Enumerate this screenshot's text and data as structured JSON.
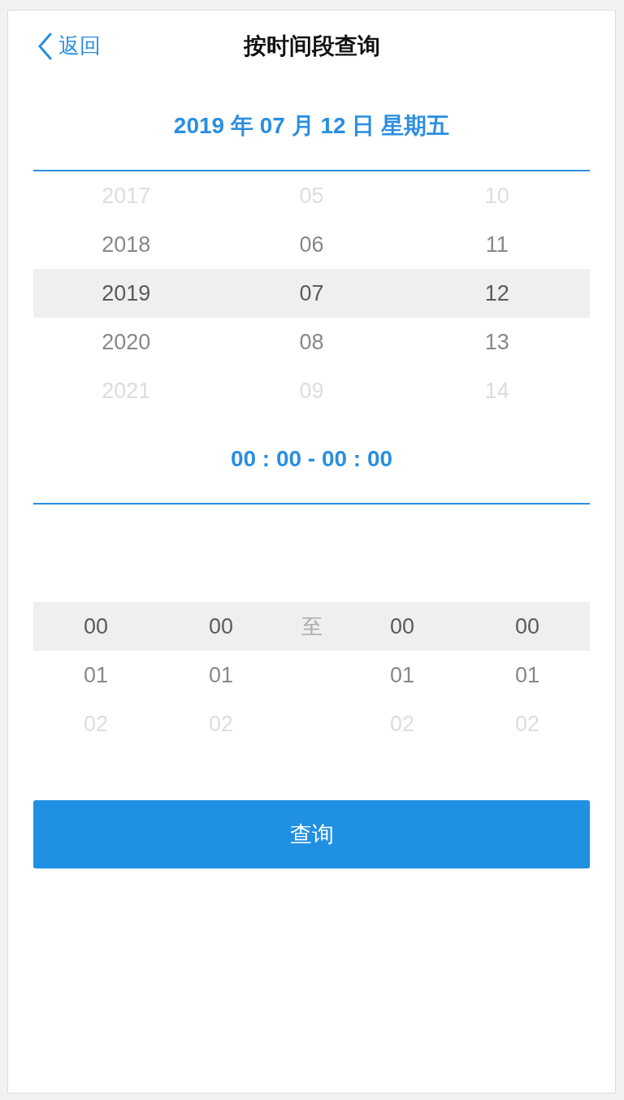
{
  "header": {
    "back_label": "返回",
    "title": "按时间段查询"
  },
  "date_picker": {
    "heading": "2019 年 07 月 12 日 星期五",
    "columns": [
      {
        "items": [
          {
            "label": "2017",
            "selected": false
          },
          {
            "label": "2018",
            "selected": false
          },
          {
            "label": "2019",
            "selected": true
          },
          {
            "label": "2020",
            "selected": false
          },
          {
            "label": "2021",
            "selected": false
          }
        ]
      },
      {
        "items": [
          {
            "label": "05",
            "selected": false
          },
          {
            "label": "06",
            "selected": false
          },
          {
            "label": "07",
            "selected": true
          },
          {
            "label": "08",
            "selected": false
          },
          {
            "label": "09",
            "selected": false
          }
        ]
      },
      {
        "items": [
          {
            "label": "10",
            "selected": false
          },
          {
            "label": "11",
            "selected": false
          },
          {
            "label": "12",
            "selected": true
          },
          {
            "label": "13",
            "selected": false
          },
          {
            "label": "14",
            "selected": false
          }
        ]
      }
    ]
  },
  "time_picker": {
    "heading": "00 : 00 - 00 : 00",
    "columns": [
      {
        "kind": "wheel",
        "items": [
          {
            "label": "00",
            "selected": true
          },
          {
            "label": "01",
            "selected": false
          },
          {
            "label": "02",
            "selected": false
          }
        ]
      },
      {
        "kind": "wheel",
        "items": [
          {
            "label": "00",
            "selected": true
          },
          {
            "label": "01",
            "selected": false
          },
          {
            "label": "02",
            "selected": false
          }
        ]
      },
      {
        "kind": "separator",
        "label": "至"
      },
      {
        "kind": "wheel",
        "items": [
          {
            "label": "00",
            "selected": true
          },
          {
            "label": "01",
            "selected": false
          },
          {
            "label": "02",
            "selected": false
          }
        ]
      },
      {
        "kind": "wheel",
        "items": [
          {
            "label": "00",
            "selected": true
          },
          {
            "label": "01",
            "selected": false
          },
          {
            "label": "02",
            "selected": false
          }
        ]
      }
    ]
  },
  "submit_button": "查询"
}
